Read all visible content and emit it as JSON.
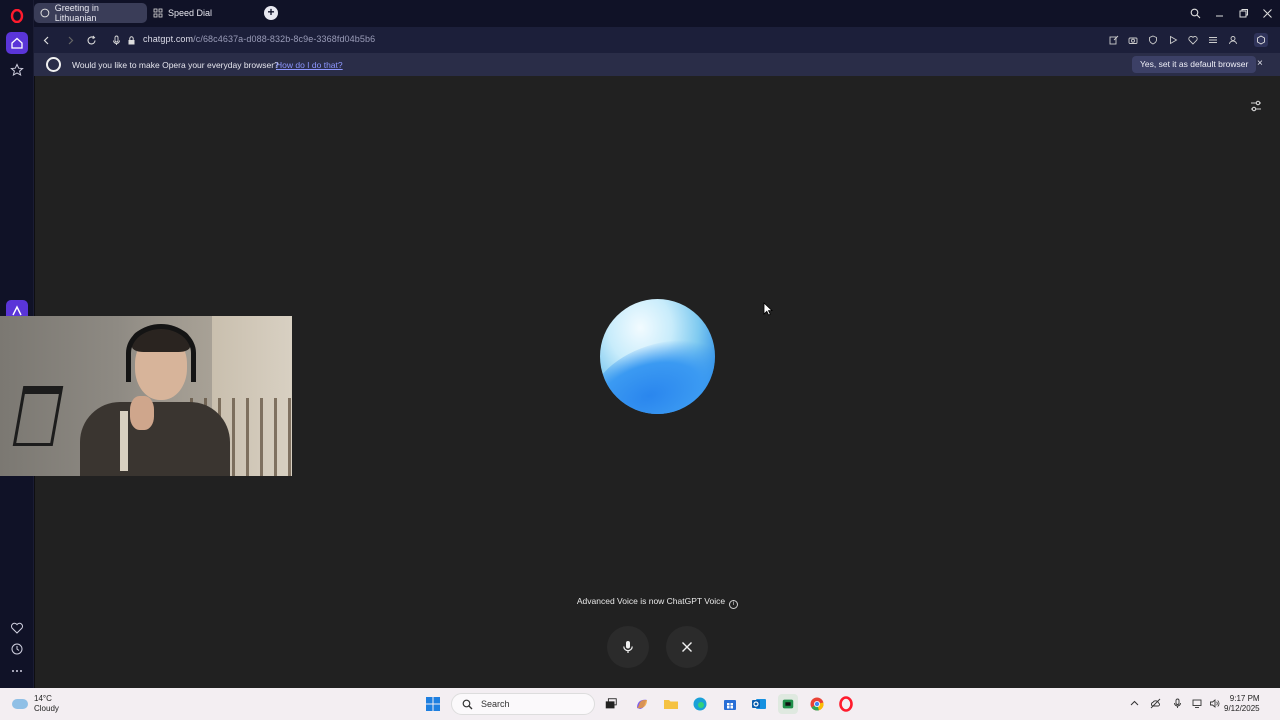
{
  "browser": {
    "tabs": [
      {
        "label": "Greeting in Lithuanian",
        "active": true
      },
      {
        "label": "Speed Dial",
        "active": false
      }
    ],
    "url_host": "chatgpt.com",
    "url_path": "/c/68c4637a-d088-832b-8c9e-3368fd04b5b6"
  },
  "infobar": {
    "message": "Would you like to make Opera your everyday browser?",
    "link": "How do I do that?",
    "cta": "Yes, set it as default browser",
    "close": "×"
  },
  "voice": {
    "notice": "Advanced Voice is now ChatGPT Voice",
    "info_glyph": "i"
  },
  "taskbar": {
    "weather_temp": "14°C",
    "weather_desc": "Cloudy",
    "search_placeholder": "Search",
    "time": "9:17 PM",
    "date": "9/12/2025"
  },
  "colors": {
    "accent_link": "#8d97ff",
    "content_bg": "#212121",
    "sidebar_bg": "#101227"
  }
}
